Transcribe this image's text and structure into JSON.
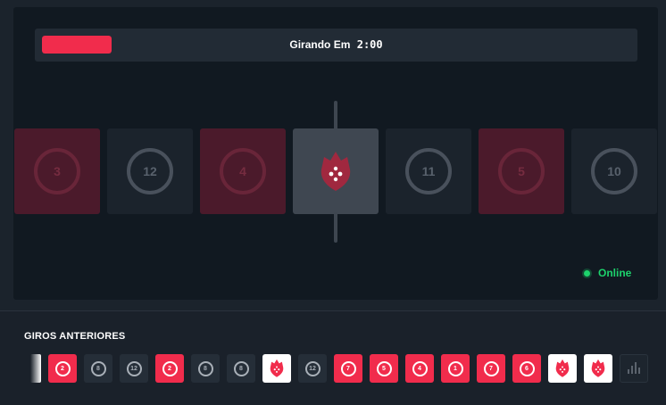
{
  "status": {
    "label": "Girando Em",
    "timer": "2:00",
    "progress_fraction": 0.12,
    "accent": "#f12c4c"
  },
  "roulette": {
    "tiles": [
      {
        "color": "red",
        "number": "3"
      },
      {
        "color": "black",
        "number": "12"
      },
      {
        "color": "red",
        "number": "4"
      },
      {
        "color": "white",
        "icon": "blaze-logo-icon"
      },
      {
        "color": "black",
        "number": "11"
      },
      {
        "color": "red",
        "number": "5"
      },
      {
        "color": "black",
        "number": "10"
      }
    ]
  },
  "connection": {
    "label": "Online",
    "color": "#1dd26c"
  },
  "history": {
    "title": "GIROS ANTERIORES",
    "items": [
      {
        "color": "red",
        "number": "2"
      },
      {
        "color": "black",
        "number": "8"
      },
      {
        "color": "black",
        "number": "12"
      },
      {
        "color": "red",
        "number": "2"
      },
      {
        "color": "black",
        "number": "8"
      },
      {
        "color": "black",
        "number": "8"
      },
      {
        "color": "white",
        "icon": "blaze-logo-icon"
      },
      {
        "color": "black",
        "number": "12"
      },
      {
        "color": "red",
        "number": "7"
      },
      {
        "color": "red",
        "number": "5"
      },
      {
        "color": "red",
        "number": "4"
      },
      {
        "color": "red",
        "number": "1"
      },
      {
        "color": "red",
        "number": "7"
      },
      {
        "color": "red",
        "number": "6"
      },
      {
        "color": "white",
        "icon": "blaze-logo-icon"
      },
      {
        "color": "white",
        "icon": "blaze-logo-icon"
      }
    ],
    "stats_icon": "bar-chart-icon"
  }
}
